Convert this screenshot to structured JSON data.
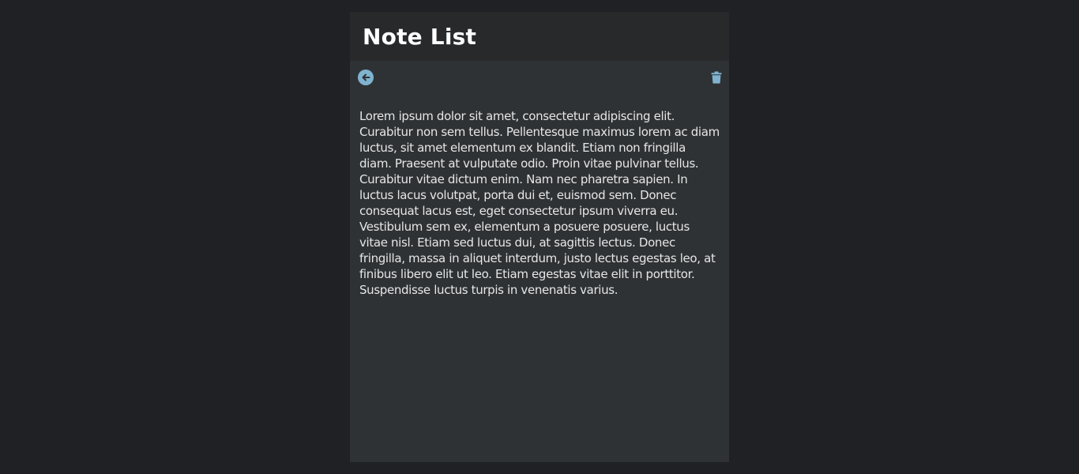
{
  "header": {
    "title": "Note List"
  },
  "toolbar": {
    "back_icon": "arrow-left-circle-icon",
    "delete_icon": "trash-icon",
    "accent_color": "#7fb3cf"
  },
  "note": {
    "body": "Lorem ipsum dolor sit amet, consectetur adipiscing elit. Curabitur non sem tellus. Pellentesque maximus lorem ac diam luctus, sit amet elementum ex blandit. Etiam non fringilla diam. Praesent at vulputate odio. Proin vitae pulvinar tellus. Curabitur vitae dictum enim. Nam nec pharetra sapien. In luctus lacus volutpat, porta dui et, euismod sem. Donec consequat lacus est, eget consectetur ipsum viverra eu. Vestibulum sem ex, elementum a posuere posuere, luctus vitae nisl. Etiam sed luctus dui, at sagittis lectus. Donec fringilla, massa in aliquet interdum, justo lectus egestas leo, at finibus libero elit ut leo. Etiam egestas vitae elit in porttitor. Suspendisse luctus turpis in venenatis varius."
  }
}
